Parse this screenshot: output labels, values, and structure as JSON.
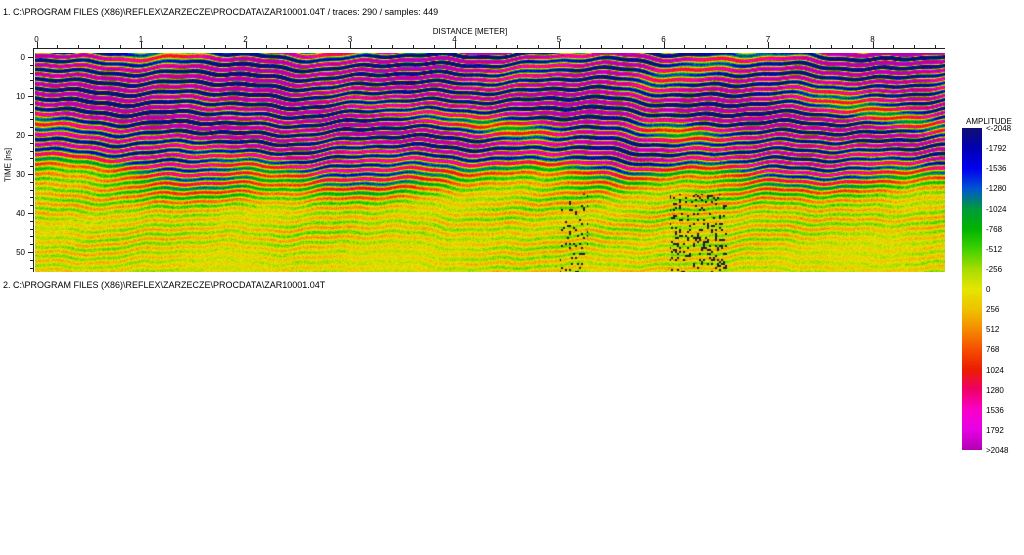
{
  "panel1": {
    "title": "1. C:\\PROGRAM FILES (X86)\\REFLEX\\ZARZECZE\\PROCDATA\\ZAR10001.04T / traces: 290 / samples: 449"
  },
  "panel2": {
    "title": "2. C:\\PROGRAM FILES (X86)\\REFLEX\\ZARZECZE\\PROCDATA\\ZAR10001.04T"
  },
  "chart_data": {
    "type": "heatmap",
    "title": "C:\\PROGRAM FILES (X86)\\REFLEX\\ZARZECZE\\PROCDATA\\ZAR10001.04T",
    "traces": 290,
    "samples": 449,
    "xlabel": "DISTANCE [METER]",
    "ylabel": "TIME [ns]",
    "xlim": [
      0,
      8.7
    ],
    "ylim": [
      0,
      55
    ],
    "x_ticks": [
      0,
      1,
      2,
      3,
      4,
      5,
      6,
      7,
      8
    ],
    "x_minor_step": 0.2,
    "y_ticks": [
      0,
      10,
      20,
      30,
      40,
      50
    ],
    "y_minor_step": 2,
    "grid": false,
    "legend_position": "right",
    "colorbar": {
      "title": "AMPLITUDE",
      "tick_labels": [
        "<-2048",
        "-1792",
        "-1536",
        "-1280",
        "-1024",
        "-768",
        "-512",
        "-256",
        "0",
        "256",
        "512",
        "768",
        "1024",
        "1280",
        "1536",
        "1792",
        ">2048"
      ],
      "palette": [
        {
          "v": -2048,
          "c": "#0f0f73"
        },
        {
          "v": -1792,
          "c": "#0000b4"
        },
        {
          "v": -1536,
          "c": "#0000ef"
        },
        {
          "v": -1280,
          "c": "#0055d2"
        },
        {
          "v": -1024,
          "c": "#009b3c"
        },
        {
          "v": -768,
          "c": "#00b400"
        },
        {
          "v": -512,
          "c": "#3fd200"
        },
        {
          "v": -256,
          "c": "#a5dc00"
        },
        {
          "v": 0,
          "c": "#e6e600"
        },
        {
          "v": 256,
          "c": "#eec300"
        },
        {
          "v": 512,
          "c": "#f58c00"
        },
        {
          "v": 768,
          "c": "#f55000"
        },
        {
          "v": 1024,
          "c": "#eb1e00"
        },
        {
          "v": 1280,
          "c": "#f00064"
        },
        {
          "v": 1536,
          "c": "#fa00c8"
        },
        {
          "v": 1792,
          "c": "#e600e6"
        },
        {
          "v": 2048,
          "c": "#b400b4"
        }
      ]
    },
    "description": "GPR radargram: strong alternating magenta and navy-blue wavy horizontal reflection bands from 0 to ~30 ns with scattered yellow/green/red patches, a mixed green/red/magenta zone around 30-40 ns, fading to a low-amplitude yellow background with thin red and green striations and sparse dark speckle noise below ~40 ns."
  }
}
